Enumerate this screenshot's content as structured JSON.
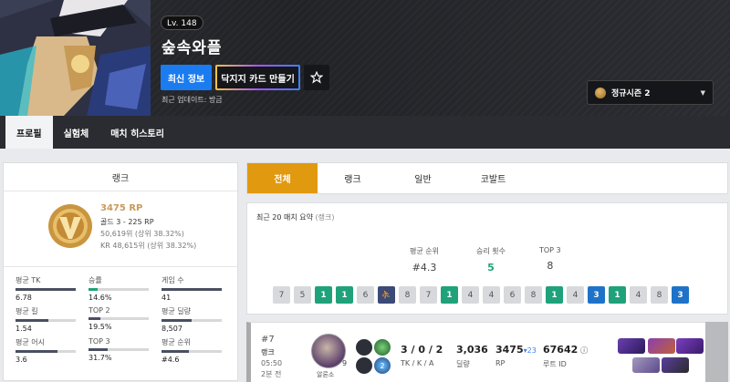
{
  "header": {
    "level": "Lv. 148",
    "player_name": "숲속와플",
    "refresh_button": "최신 정보",
    "card_button": "닥지지 카드 만들기",
    "updated": "최근 업데이트: 방금",
    "season": "정규시즌 2"
  },
  "nav": [
    "프로필",
    "실험체",
    "매치 히스토리"
  ],
  "rank_panel": {
    "title": "랭크",
    "rp": "3475 RP",
    "tier": "골드 3 - 225 RP",
    "rank_global": "50,619위 (상위 38.32%)",
    "rank_kr": "KR 48,615위 (상위 38.32%)"
  },
  "stats": [
    {
      "label": "평균 TK",
      "value": "6.78",
      "fill": 1.0,
      "color": "#4a4f60"
    },
    {
      "label": "승률",
      "value": "14.6%",
      "fill": 0.15,
      "color": "#1fa27a"
    },
    {
      "label": "게임 수",
      "value": "41",
      "fill": 1.0,
      "color": "#4a4f60"
    },
    {
      "label": "평균 킬",
      "value": "1.54",
      "fill": 0.55,
      "color": "#4a4f60"
    },
    {
      "label": "TOP 2",
      "value": "19.5%",
      "fill": 0.2,
      "color": "#4a4f60"
    },
    {
      "label": "평균 딜량",
      "value": "8,507",
      "fill": 0.5,
      "color": "#4a4f60"
    },
    {
      "label": "평균 어시",
      "value": "3.6",
      "fill": 0.7,
      "color": "#4a4f60"
    },
    {
      "label": "TOP 3",
      "value": "31.7%",
      "fill": 0.32,
      "color": "#4a4f60"
    },
    {
      "label": "평균 순위",
      "value": "#4.6",
      "fill": 0.45,
      "color": "#4a4f60"
    }
  ],
  "tabs": [
    "전체",
    "랭크",
    "일반",
    "코발트"
  ],
  "summary": {
    "title": "최근 20 매치 요약",
    "title_sub": "(랭크)",
    "avg_place_label": "평균 순위",
    "avg_place": "#4.3",
    "wins_label": "승리 횟수",
    "wins": "5",
    "top3_label": "TOP 3",
    "top3": "8",
    "places": [
      {
        "v": "7",
        "t": "n"
      },
      {
        "v": "5",
        "t": "n"
      },
      {
        "v": "1",
        "t": "g"
      },
      {
        "v": "1",
        "t": "g"
      },
      {
        "v": "6",
        "t": "n"
      },
      {
        "v": "⛹",
        "t": "x"
      },
      {
        "v": "8",
        "t": "n"
      },
      {
        "v": "7",
        "t": "n"
      },
      {
        "v": "1",
        "t": "g"
      },
      {
        "v": "4",
        "t": "n"
      },
      {
        "v": "4",
        "t": "n"
      },
      {
        "v": "6",
        "t": "n"
      },
      {
        "v": "8",
        "t": "n"
      },
      {
        "v": "1",
        "t": "g"
      },
      {
        "v": "4",
        "t": "n"
      },
      {
        "v": "3",
        "t": "b"
      },
      {
        "v": "1",
        "t": "g"
      },
      {
        "v": "4",
        "t": "n"
      },
      {
        "v": "8",
        "t": "n"
      },
      {
        "v": "3",
        "t": "b"
      }
    ]
  },
  "match": {
    "rank": "#7",
    "type": "랭크",
    "duration": "05:50",
    "ago": "2분 전",
    "char_level": "9",
    "char_name": "알론소",
    "kda": "3 / 0 / 2",
    "kda_label": "TK / K / A",
    "damage": "3,036",
    "damage_label": "딜량",
    "rp": "3475",
    "rp_change": "▾23",
    "rp_label": "RP",
    "route": "67642",
    "route_label": "루트 ID",
    "skill_badge": "2"
  }
}
